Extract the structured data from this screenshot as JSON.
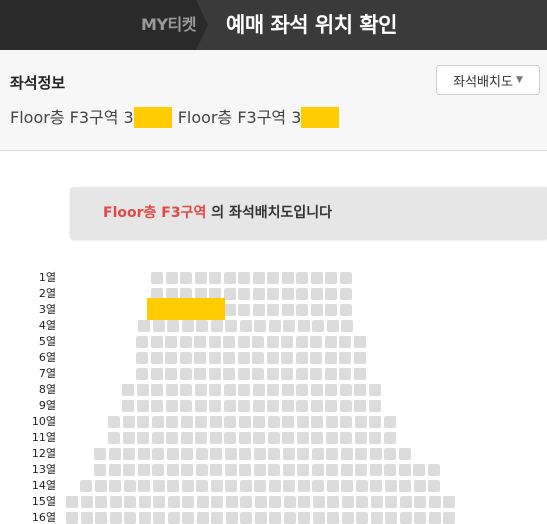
{
  "header": {
    "breadcrumb": "MY티켓",
    "title": "예매 좌석 위치 확인"
  },
  "info": {
    "label": "좌석정보",
    "layout_button": "좌석배치도",
    "layout_button_icon": "triangle-down-icon",
    "seat_line": [
      "Floor층 F3구역 3",
      "Floor층 F3구역 3"
    ]
  },
  "banner": {
    "highlight": "Floor층 F3구역",
    "text": " 의 좌석배치도입니다"
  },
  "seatmap": {
    "rows": [
      "1열",
      "2열",
      "3열",
      "4열",
      "5열",
      "6열",
      "7열",
      "8열",
      "9열",
      "10열",
      "11열",
      "12열",
      "13열",
      "14열",
      "15열",
      "16열"
    ],
    "selected_row": "3열",
    "colors": {
      "seat": "#dcdcdc",
      "selected": "#ffcc00",
      "highlight_text": "#e24848"
    }
  }
}
